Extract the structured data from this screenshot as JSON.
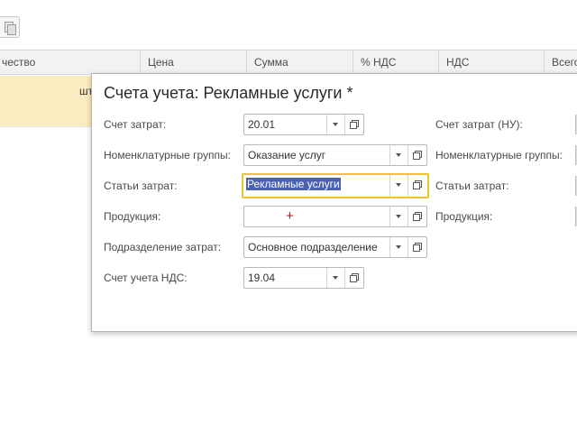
{
  "grid": {
    "columns": [
      "чество",
      "Цена",
      "Сумма",
      "% НДС",
      "НДС",
      "Всего"
    ],
    "row": {
      "unit": "шт"
    }
  },
  "dialog": {
    "title": "Счета учета: Рекламные услуги *",
    "left": [
      {
        "label": "Счет затрат:",
        "value": "20.01"
      },
      {
        "label": "Номенклатурные группы:",
        "value": "Оказание услуг"
      },
      {
        "label": "Статьи затрат:",
        "value": "Рекламные услуги"
      },
      {
        "label": "Продукция:",
        "value": ""
      },
      {
        "label": "Подразделение затрат:",
        "value": "Основное подразделение"
      },
      {
        "label": "Счет учета НДС:",
        "value": "19.04"
      }
    ],
    "right": [
      {
        "label": "Счет затрат (НУ):"
      },
      {
        "label": "Номенклатурные группы:"
      },
      {
        "label": "Статьи затрат:"
      },
      {
        "label": "Продукция:"
      }
    ],
    "marker": "+"
  },
  "colors": {
    "focus": "#f2c230",
    "selection": "#4b62b2",
    "row_highlight": "#fbedc1"
  }
}
